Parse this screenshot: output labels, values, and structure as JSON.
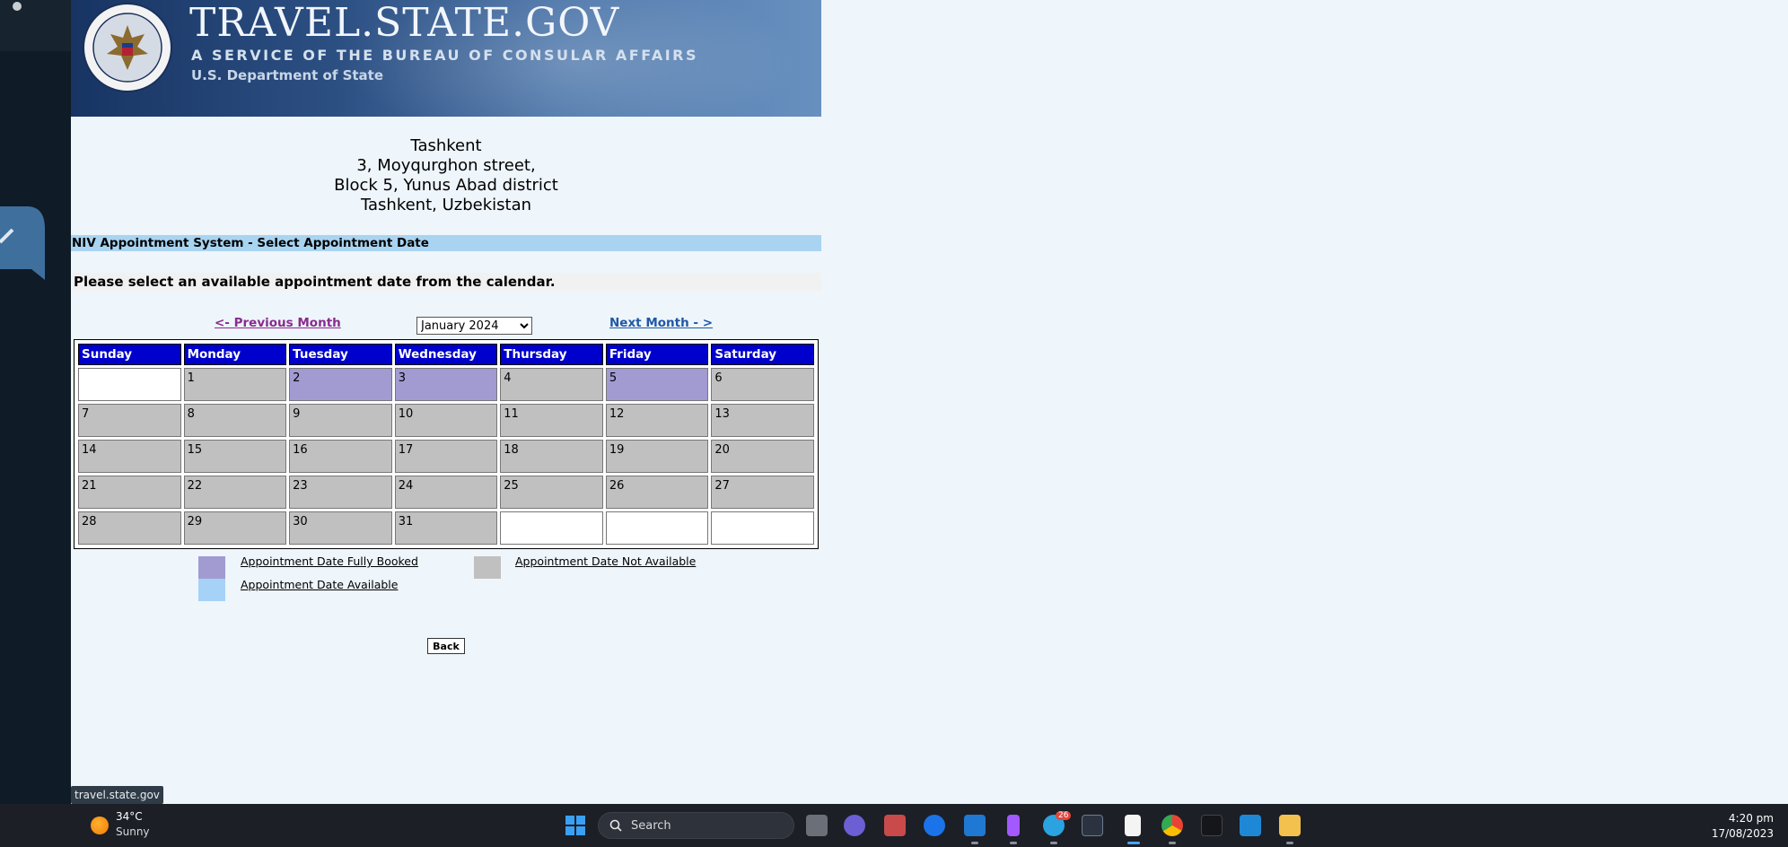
{
  "banner": {
    "title": "TRAVEL.STATE.GOV",
    "subtitle": "A SERVICE OF THE BUREAU OF CONSULAR AFFAIRS",
    "department": "U.S. Department of State",
    "seal_text": "DEPARTMENT OF STATE · UNITED STATES OF AMERICA"
  },
  "address": {
    "line1": "Tashkent",
    "line2": "3, Moyqurghon street,",
    "line3": "Block 5, Yunus Abad district",
    "line4": "Tashkent, Uzbekistan"
  },
  "section_title": "NIV Appointment System - Select Appointment Date",
  "instruction": "Please select an available appointment date from the calendar.",
  "navigation": {
    "prev_label": "<- Previous Month",
    "next_label": "Next Month - >",
    "selected_month": "January  2024"
  },
  "calendar": {
    "weekdays": [
      "Sunday",
      "Monday",
      "Tuesday",
      "Wednesday",
      "Thursday",
      "Friday",
      "Saturday"
    ],
    "weeks": [
      [
        {
          "day": "",
          "status": "empty"
        },
        {
          "day": "1",
          "status": "na"
        },
        {
          "day": "2",
          "status": "booked"
        },
        {
          "day": "3",
          "status": "booked"
        },
        {
          "day": "4",
          "status": "na"
        },
        {
          "day": "5",
          "status": "booked"
        },
        {
          "day": "6",
          "status": "na"
        }
      ],
      [
        {
          "day": "7",
          "status": "na"
        },
        {
          "day": "8",
          "status": "na"
        },
        {
          "day": "9",
          "status": "na"
        },
        {
          "day": "10",
          "status": "na"
        },
        {
          "day": "11",
          "status": "na"
        },
        {
          "day": "12",
          "status": "na"
        },
        {
          "day": "13",
          "status": "na"
        }
      ],
      [
        {
          "day": "14",
          "status": "na"
        },
        {
          "day": "15",
          "status": "na"
        },
        {
          "day": "16",
          "status": "na"
        },
        {
          "day": "17",
          "status": "na"
        },
        {
          "day": "18",
          "status": "na"
        },
        {
          "day": "19",
          "status": "na"
        },
        {
          "day": "20",
          "status": "na"
        }
      ],
      [
        {
          "day": "21",
          "status": "na"
        },
        {
          "day": "22",
          "status": "na"
        },
        {
          "day": "23",
          "status": "na"
        },
        {
          "day": "24",
          "status": "na"
        },
        {
          "day": "25",
          "status": "na"
        },
        {
          "day": "26",
          "status": "na"
        },
        {
          "day": "27",
          "status": "na"
        }
      ],
      [
        {
          "day": "28",
          "status": "na"
        },
        {
          "day": "29",
          "status": "na"
        },
        {
          "day": "30",
          "status": "na"
        },
        {
          "day": "31",
          "status": "na"
        },
        {
          "day": "",
          "status": "empty"
        },
        {
          "day": "",
          "status": "empty"
        },
        {
          "day": "",
          "status": "empty"
        }
      ]
    ]
  },
  "legend": {
    "fully_booked": "Appointment Date Fully Booked",
    "not_available": "Appointment Date Not Available",
    "available": "Appointment Date Available",
    "colors": {
      "fully_booked": "#a19bd2",
      "not_available": "#c0c0c0",
      "available": "#a6d2f7"
    }
  },
  "back_button": "Back",
  "status_url": "travel.state.gov",
  "taskbar": {
    "weather_temp": "34°C",
    "weather_condition": "Sunny",
    "search_label": "Search",
    "telegram_badge": "26",
    "time": "4:20 pm",
    "date": "17/08/2023"
  },
  "colors": {
    "header_blue": "#0000cc",
    "section_bar": "#a8d4f1",
    "prev_link": "#8a2b8e",
    "next_link": "#1f57a6",
    "page_bg": "#eef5fb"
  }
}
